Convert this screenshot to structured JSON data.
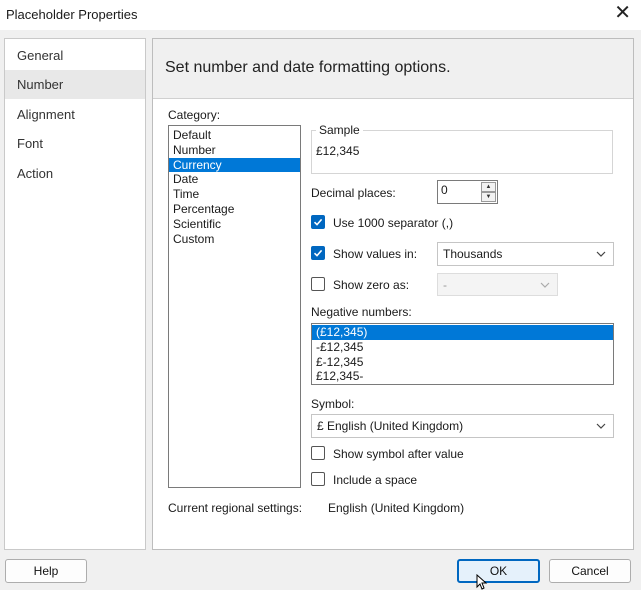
{
  "window": {
    "title": "Placeholder Properties"
  },
  "nav": {
    "items": [
      {
        "label": "General"
      },
      {
        "label": "Number"
      },
      {
        "label": "Alignment"
      },
      {
        "label": "Font"
      },
      {
        "label": "Action"
      }
    ],
    "selected": "Number"
  },
  "header": {
    "text": "Set number and date formatting options."
  },
  "category": {
    "label": "Category:",
    "items": [
      "Default",
      "Number",
      "Currency",
      "Date",
      "Time",
      "Percentage",
      "Scientific",
      "Custom"
    ],
    "selected": "Currency"
  },
  "sample": {
    "label": "Sample",
    "value": "£12,345"
  },
  "decimal_places": {
    "label": "Decimal places:",
    "value": "0"
  },
  "use_separator": {
    "label": "Use 1000 separator (,)",
    "checked": true
  },
  "show_values_in": {
    "label": "Show values in:",
    "checked": true,
    "value": "Thousands"
  },
  "show_zero_as": {
    "label": "Show zero as:",
    "checked": false,
    "value": "-"
  },
  "negative_numbers": {
    "label": "Negative numbers:",
    "items": [
      "(£12,345)",
      "-£12,345",
      "£-12,345",
      "£12,345-"
    ],
    "selected": "(£12,345)"
  },
  "symbol": {
    "label": "Symbol:",
    "value": "£ English (United Kingdom)"
  },
  "show_symbol_after": {
    "label": "Show symbol after value",
    "checked": false
  },
  "include_space": {
    "label": "Include a space",
    "checked": false
  },
  "regional": {
    "label": "Current regional settings:",
    "value": "English (United Kingdom)"
  },
  "buttons": {
    "help": "Help",
    "ok": "OK",
    "cancel": "Cancel"
  },
  "colors": {
    "selection": "#0078d7",
    "checkbox": "#0067c0"
  }
}
